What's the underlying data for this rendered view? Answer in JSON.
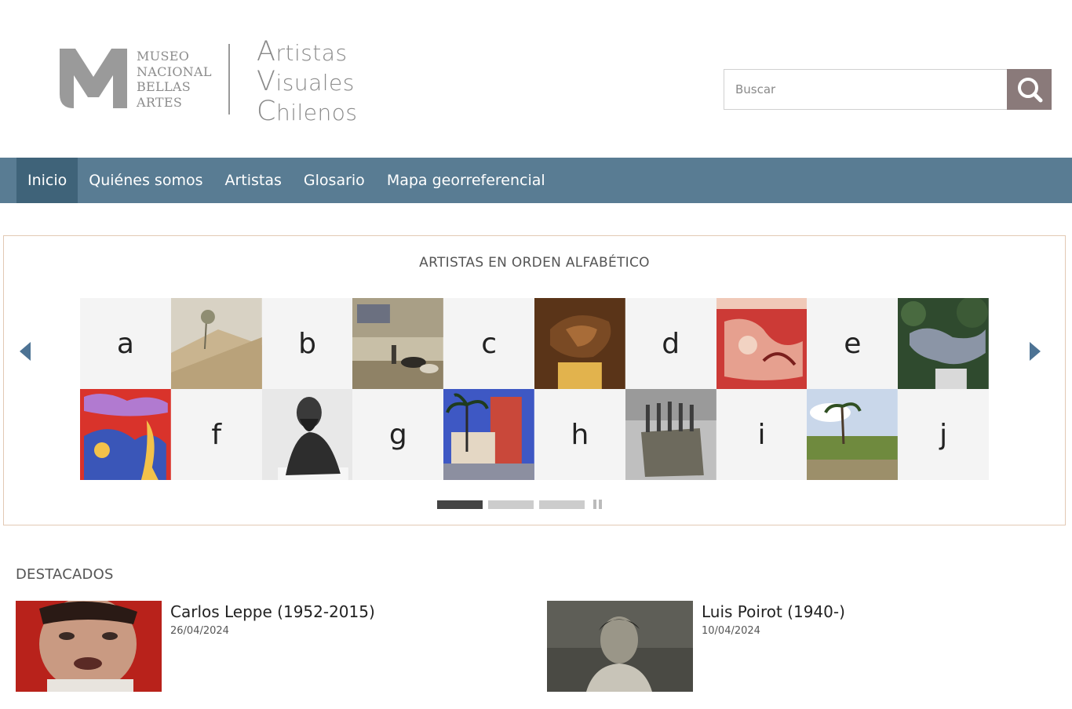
{
  "header": {
    "logo": {
      "museo_lines": [
        "MUSEO",
        "NACIONAL",
        "BELLAS",
        "ARTES"
      ],
      "avc_lines": [
        {
          "cap": "A",
          "rest": "rtistas"
        },
        {
          "cap": "V",
          "rest": "isuales"
        },
        {
          "cap": "C",
          "rest": "hilenos"
        }
      ]
    },
    "search": {
      "placeholder": "Buscar",
      "value": "",
      "button_icon": "search-icon",
      "button_color": "#8a7a7a"
    }
  },
  "nav": {
    "color": "#597c93",
    "active_color": "#3f6379",
    "items": [
      {
        "label": "Inicio",
        "active": true
      },
      {
        "label": "Quiénes somos",
        "active": false
      },
      {
        "label": "Artistas",
        "active": false
      },
      {
        "label": "Glosario",
        "active": false
      },
      {
        "label": "Mapa georreferencial",
        "active": false
      }
    ]
  },
  "alphabet": {
    "title": "ARTISTAS EN ORDEN ALFABÉTICO",
    "prev_icon": "triangle-left-icon",
    "next_icon": "triangle-right-icon",
    "row1": [
      "a",
      "img-landscape-tree",
      "b",
      "img-farm-animals",
      "c",
      "img-bronze-sculpture",
      "d",
      "img-red-mural",
      "e",
      "img-metal-figure"
    ],
    "row2": [
      "img-colorful-abstract",
      "f",
      "img-bearded-bust",
      "g",
      "img-city-palms",
      "h",
      "img-figures-cube",
      "i",
      "img-palm-landscape",
      "j"
    ],
    "pagination": {
      "pages": 3,
      "current": 1,
      "pause_icon": "pause-icon"
    }
  },
  "destacados": {
    "title": "DESTACADOS",
    "items": [
      {
        "name": "Carlos Leppe (1952-2015)",
        "date": "26/04/2024",
        "thumb": "img-face-red"
      },
      {
        "name": "Luis Poirot (1940-)",
        "date": "10/04/2024",
        "thumb": "img-portrait-bw"
      }
    ]
  }
}
